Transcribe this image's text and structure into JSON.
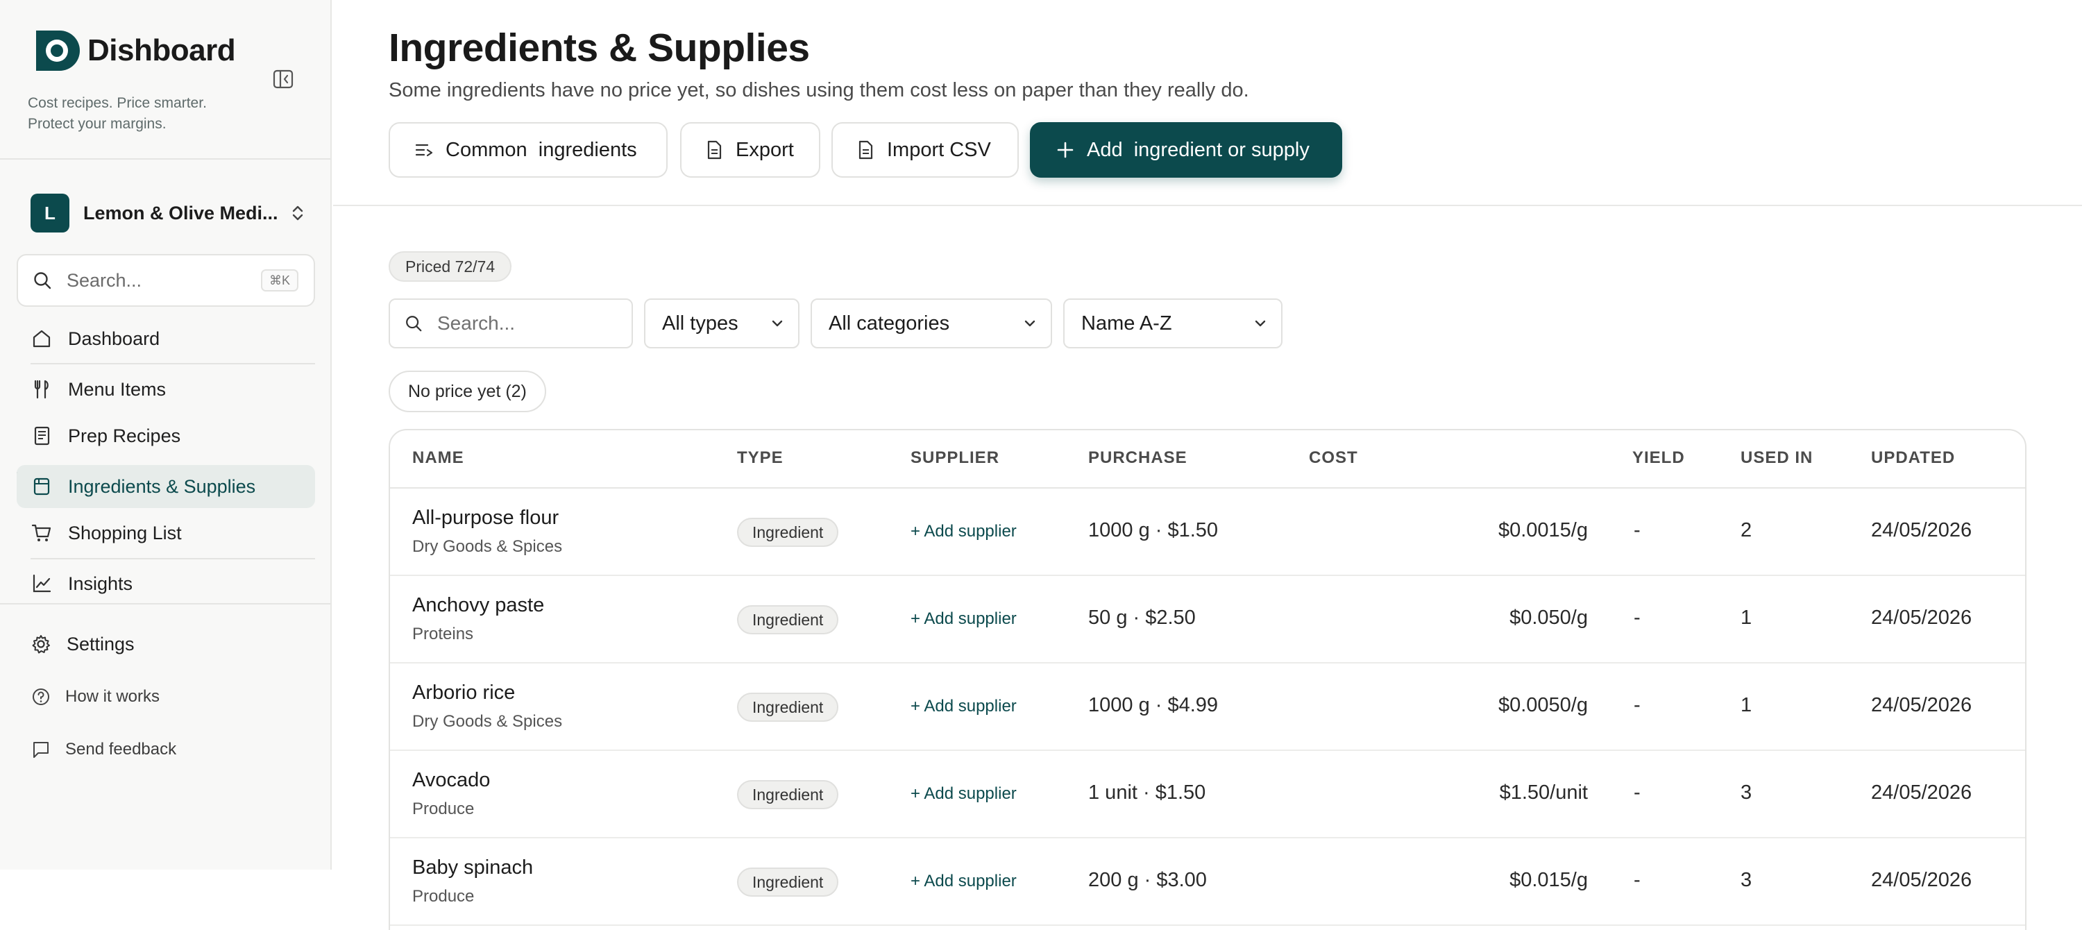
{
  "colors": {
    "brand": "#0c4a4d",
    "sidebar_bg": "#f8f8f7",
    "active_bg": "#e7ecea"
  },
  "sidebar": {
    "brand": "Dishboard",
    "tagline": "Cost recipes. Price smarter. Protect your margins.",
    "org": {
      "initial": "L",
      "name": "Lemon & Olive Medi..."
    },
    "search": {
      "placeholder": "Search...",
      "shortcut": "⌘K"
    },
    "nav": [
      {
        "label": "Dashboard",
        "icon": "home-icon"
      },
      {
        "label": "Menu Items",
        "icon": "utensils-icon"
      },
      {
        "label": "Prep Recipes",
        "icon": "recipe-book-icon"
      },
      {
        "label": "Ingredients & Supplies",
        "icon": "package-icon",
        "active": true
      },
      {
        "label": "Shopping List",
        "icon": "cart-icon"
      },
      {
        "label": "Insights",
        "icon": "chart-line-icon"
      }
    ],
    "footer": [
      {
        "label": "Settings",
        "icon": "gear-icon"
      },
      {
        "label": "How it works",
        "icon": "help-circle-icon"
      },
      {
        "label": "Send feedback",
        "icon": "message-icon"
      }
    ]
  },
  "header": {
    "title": "Ingredients & Supplies",
    "subtitle": "Some ingredients have no price yet, so dishes using them cost less on paper than they really do.",
    "buttons": {
      "common": "Common  ingredients",
      "export": "Export",
      "import": "Import CSV",
      "add": "Add  ingredient or supply"
    }
  },
  "filters": {
    "priced_badge": "Priced 72/74",
    "search_placeholder": "Search...",
    "type": "All types",
    "category": "All categories",
    "sort": "Name A-Z",
    "no_price_chip": "No price yet (2)"
  },
  "table": {
    "columns": [
      "NAME",
      "TYPE",
      "SUPPLIER",
      "PURCHASE",
      "COST",
      "YIELD",
      "USED IN",
      "UPDATED"
    ],
    "rows": [
      {
        "name": "All-purpose flour",
        "category": "Dry Goods & Spices",
        "type": "Ingredient",
        "supplier": "+ Add supplier",
        "purchase": "1000 g · $1.50",
        "cost": "$0.0015/g",
        "yield": "-",
        "used_in": "2",
        "updated": "24/05/2026"
      },
      {
        "name": "Anchovy paste",
        "category": "Proteins",
        "type": "Ingredient",
        "supplier": "+ Add supplier",
        "purchase": "50 g · $2.50",
        "cost": "$0.050/g",
        "yield": "-",
        "used_in": "1",
        "updated": "24/05/2026"
      },
      {
        "name": "Arborio rice",
        "category": "Dry Goods & Spices",
        "type": "Ingredient",
        "supplier": "+ Add supplier",
        "purchase": "1000 g · $4.99",
        "cost": "$0.0050/g",
        "yield": "-",
        "used_in": "1",
        "updated": "24/05/2026"
      },
      {
        "name": "Avocado",
        "category": "Produce",
        "type": "Ingredient",
        "supplier": "+ Add supplier",
        "purchase": "1 unit · $1.50",
        "cost": "$1.50/unit",
        "yield": "-",
        "used_in": "3",
        "updated": "24/05/2026"
      },
      {
        "name": "Baby spinach",
        "category": "Produce",
        "type": "Ingredient",
        "supplier": "+ Add supplier",
        "purchase": "200 g · $3.00",
        "cost": "$0.015/g",
        "yield": "-",
        "used_in": "3",
        "updated": "24/05/2026"
      }
    ]
  }
}
